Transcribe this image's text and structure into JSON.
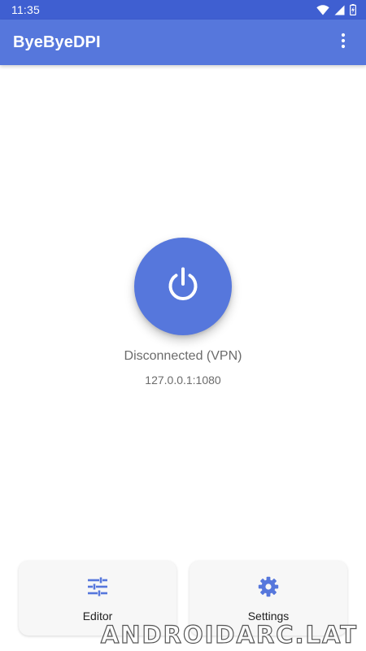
{
  "status_bar": {
    "time": "11:35",
    "icons": [
      "wifi-icon",
      "signal-icon",
      "battery-icon"
    ]
  },
  "app_bar": {
    "title": "ByeByeDPI",
    "menu_icon": "more-vert-icon"
  },
  "connection": {
    "button_icon": "power-icon",
    "status": "Disconnected (VPN)",
    "address": "127.0.0.1:1080"
  },
  "actions": [
    {
      "label": "Editor",
      "icon": "tune-sliders-icon"
    },
    {
      "label": "Settings",
      "icon": "gear-icon"
    }
  ],
  "watermark": "ANDROIDARC.LAT",
  "colors": {
    "status_bar": "#3f5fd1",
    "primary": "#5677dc",
    "text_secondary": "#6b6b6b",
    "card_bg": "#f7f7f7"
  }
}
